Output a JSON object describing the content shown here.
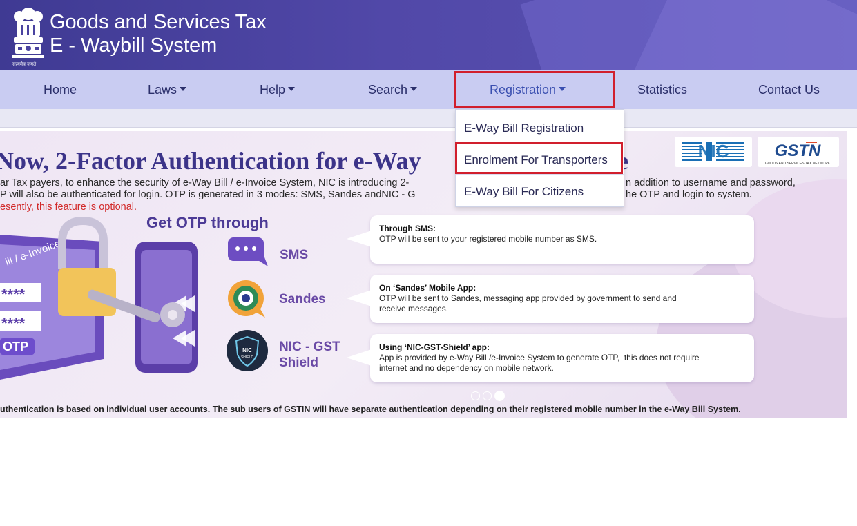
{
  "header": {
    "title_line1": "Goods and Services Tax",
    "title_line2": "E - Waybill System",
    "emblem_caption": "सत्यमेव जयते",
    "bg_color": "#4b44a2"
  },
  "nav": {
    "items": [
      {
        "label": "Home"
      },
      {
        "label": "Laws"
      },
      {
        "label": "Help"
      },
      {
        "label": "Search"
      },
      {
        "label": "Registration"
      },
      {
        "label": "Statistics"
      },
      {
        "label": "Contact Us"
      }
    ],
    "bg_color": "#c9ccf2",
    "highlight_color": "#d11f2d"
  },
  "dropdown": {
    "items": [
      {
        "label": "E-Way Bill Registration"
      },
      {
        "label": "Enrolment For Transporters"
      },
      {
        "label": "E-Way Bill For Citizens"
      }
    ]
  },
  "banner": {
    "headline": "Now, 2-Factor Authentication for e-Way",
    "headline_tail": "e",
    "para_line1_a": "ar Tax payers, to enhance the security of e-Way Bill / e-Invoice System, NIC is introducing 2-",
    "para_line1_b": "n addition to username and password,",
    "para_line2_a": "P will also be authenticated for login. OTP is generated in 3 modes: SMS, Sandes andNIC - G",
    "para_line2_b": "he OTP and login to system.",
    "para_line3": "esently, this feature is optional.",
    "get_otp": "Get OTP through",
    "options": [
      {
        "label": "SMS",
        "bubble_title": "Through SMS:",
        "bubble_text": "OTP will be sent to your registered mobile number as SMS."
      },
      {
        "label": "Sandes",
        "bubble_title": "On ‘Sandes’ Mobile App:",
        "bubble_text": "OTP will be sent to Sandes, messaging app provided by government to send and\nreceive messages."
      },
      {
        "label": "NIC - GST\nShield",
        "bubble_title": "Using ‘NIC-GST-Shield’ app:",
        "bubble_text": "App is provided by e-Way Bill /e-Invoice System to generate OTP,  this does not require\ninternet and no dependency on mobile network."
      }
    ],
    "illustration": {
      "screen_text": "ill / e-Invoice",
      "password_mask": "****",
      "otp_button": "OTP",
      "shield_badge_line1": "NIC",
      "shield_badge_line2": "SHIELD"
    },
    "footnote": "uthentication is based on individual user accounts.  The sub users of GSTIN will have separate authentication depending on their registered mobile number in the e-Way Bill System.",
    "logos": {
      "nic": "NIC",
      "gstn": "GSTN",
      "gstn_tagline": "GOODS AND SERVICES TAX NETWORK"
    },
    "carousel": {
      "count": 3,
      "active_index": 2
    }
  }
}
